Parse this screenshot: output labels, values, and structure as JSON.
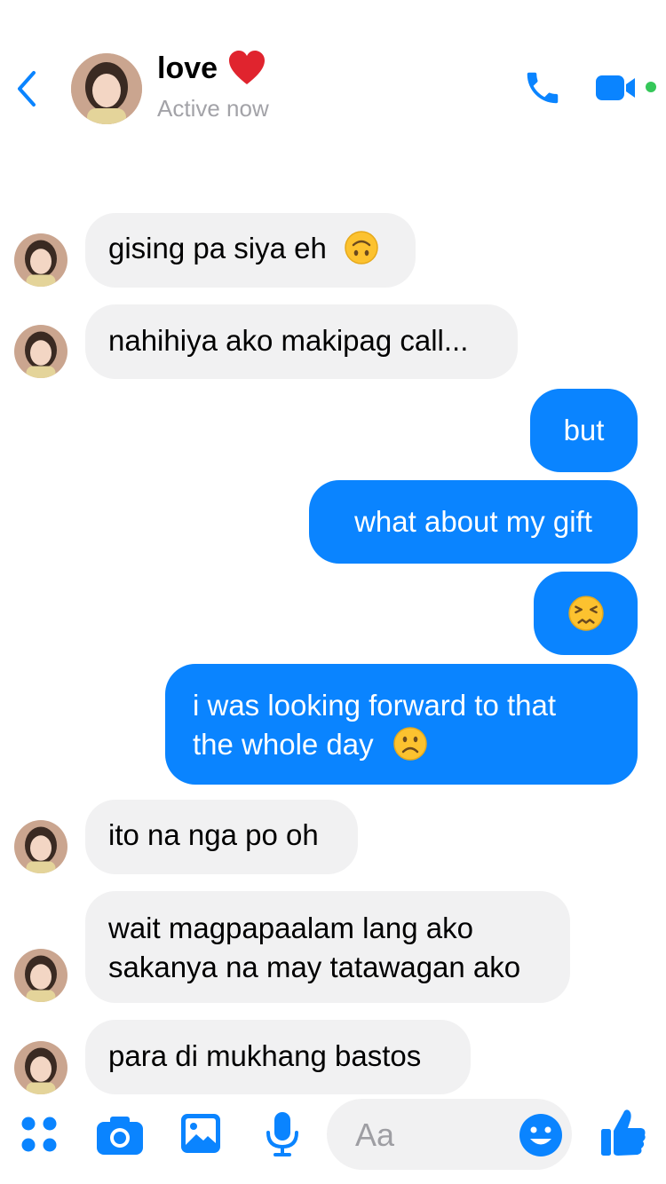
{
  "header": {
    "contact_name": "love",
    "status": "Active now",
    "back_icon": "chevron-left-icon",
    "call_icon": "phone-icon",
    "video_icon": "video-camera-icon",
    "accent": "#0a84ff",
    "online_color": "#35c759"
  },
  "messages": [
    {
      "side": "in",
      "text": "gising pa siya eh",
      "emoji": "upside-down-face"
    },
    {
      "side": "in",
      "text": "nahihiya ako makipag call..."
    },
    {
      "side": "out",
      "text": "but"
    },
    {
      "side": "out",
      "text": "what about my gift"
    },
    {
      "side": "out",
      "text": "",
      "emoji": "persevering-face"
    },
    {
      "side": "out",
      "text_line1": "i was looking forward to that",
      "text_line2": "the whole day",
      "emoji": "frowning-face"
    },
    {
      "side": "in",
      "text": "ito na nga po oh"
    },
    {
      "side": "in",
      "text_line1": "wait magpapaalam lang ako",
      "text_line2": "sakanya na may tatawagan ako"
    },
    {
      "side": "in",
      "text": "para di mukhang bastos"
    }
  ],
  "composer": {
    "placeholder": "Aa",
    "icons": [
      "apps-icon",
      "camera-icon",
      "image-icon",
      "microphone-icon",
      "emoji-icon",
      "thumbs-up-icon"
    ]
  },
  "colors": {
    "incoming_bubble": "#f1f1f2",
    "outgoing_bubble": "#0a84ff"
  }
}
